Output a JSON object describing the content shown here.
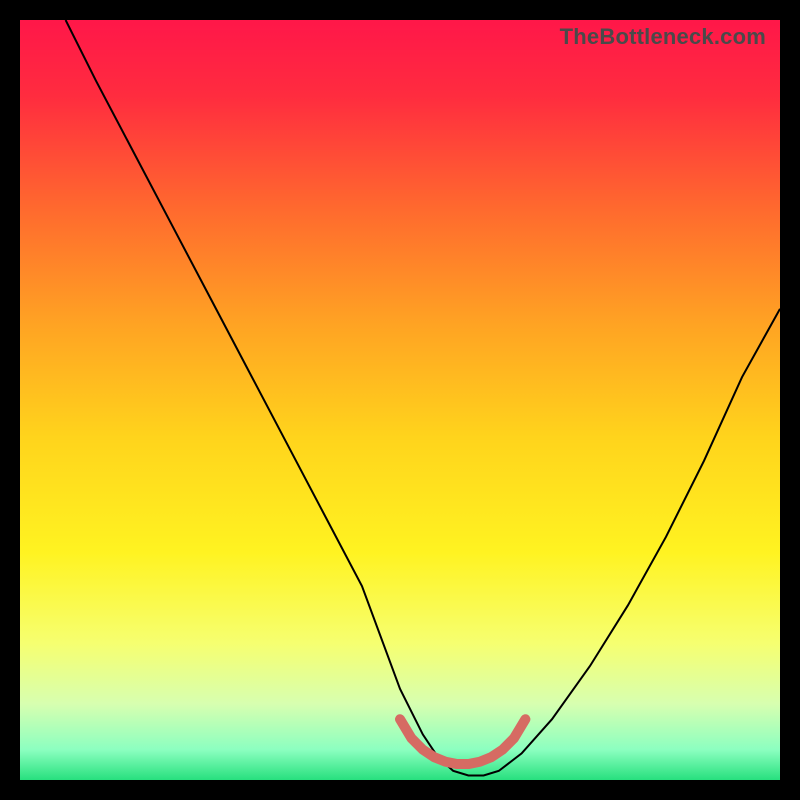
{
  "watermark_text": "TheBottleneck.com",
  "chart_data": {
    "type": "line",
    "title": "",
    "xlabel": "",
    "ylabel": "",
    "xlim": [
      0,
      100
    ],
    "ylim": [
      0,
      100
    ],
    "grid": false,
    "legend": false,
    "background": {
      "type": "vertical_gradient",
      "stops": [
        {
          "pos": 0.0,
          "color": "#ff1749"
        },
        {
          "pos": 0.1,
          "color": "#ff2c3f"
        },
        {
          "pos": 0.25,
          "color": "#ff6a2e"
        },
        {
          "pos": 0.4,
          "color": "#ffa323"
        },
        {
          "pos": 0.55,
          "color": "#ffd41c"
        },
        {
          "pos": 0.7,
          "color": "#fff321"
        },
        {
          "pos": 0.82,
          "color": "#f6ff70"
        },
        {
          "pos": 0.9,
          "color": "#d7ffb0"
        },
        {
          "pos": 0.96,
          "color": "#8cffc0"
        },
        {
          "pos": 1.0,
          "color": "#27e07e"
        }
      ]
    },
    "series": [
      {
        "name": "bottleneck-curve",
        "color": "#000000",
        "stroke_width": 2,
        "x": [
          6,
          10,
          15,
          20,
          25,
          30,
          35,
          40,
          45,
          50,
          53,
          55,
          57,
          59,
          61,
          63,
          66,
          70,
          75,
          80,
          85,
          90,
          95,
          100
        ],
        "y": [
          100,
          92,
          82.5,
          73,
          63.5,
          54,
          44.5,
          35,
          25.5,
          12,
          6,
          3,
          1.2,
          0.6,
          0.6,
          1.2,
          3.5,
          8,
          15,
          23,
          32,
          42,
          53,
          62
        ]
      },
      {
        "name": "flat-bottom-marker",
        "color": "#d66b63",
        "stroke_width": 10,
        "linecap": "round",
        "x": [
          50.0,
          51.5,
          53.0,
          54.5,
          56.0,
          57.5,
          59.0,
          60.5,
          62.0,
          63.5,
          65.0,
          66.5
        ],
        "y": [
          8.0,
          5.5,
          4.0,
          3.0,
          2.4,
          2.1,
          2.1,
          2.4,
          3.0,
          4.0,
          5.5,
          8.0
        ]
      }
    ]
  }
}
